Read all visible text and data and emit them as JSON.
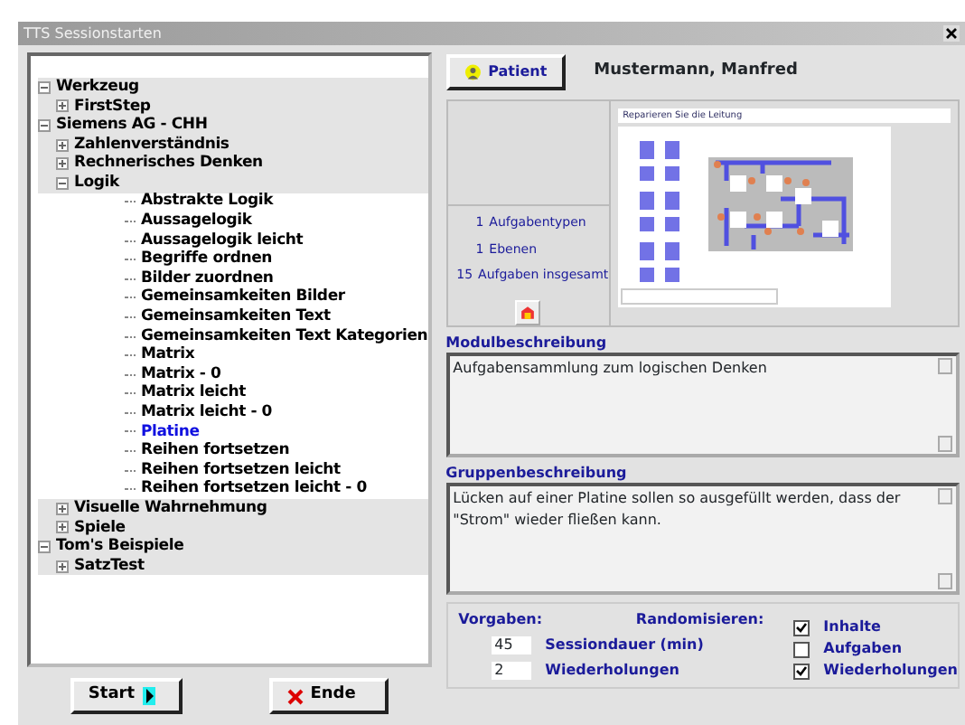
{
  "window": {
    "title": "TTS  Sessionstarten"
  },
  "tree": [
    {
      "label": "Werkzeug",
      "expanded": true,
      "selected": false,
      "children": [
        {
          "label": "FirstStep",
          "expanded": false,
          "selected": false
        }
      ]
    },
    {
      "label": "Siemens AG - CHH",
      "expanded": true,
      "selected": false,
      "children": [
        {
          "label": "Zahlenverständnis",
          "expanded": false,
          "selected": false
        },
        {
          "label": "Rechnerisches Denken",
          "expanded": false,
          "selected": false
        },
        {
          "label": "Logik",
          "expanded": true,
          "selected": false,
          "children": [
            {
              "label": "Abstrakte Logik",
              "selected": false
            },
            {
              "label": "Aussagelogik",
              "selected": false
            },
            {
              "label": "Aussagelogik leicht",
              "selected": false
            },
            {
              "label": "Begriffe ordnen",
              "selected": false
            },
            {
              "label": "Bilder zuordnen",
              "selected": false
            },
            {
              "label": "Gemeinsamkeiten Bilder",
              "selected": false
            },
            {
              "label": "Gemeinsamkeiten Text",
              "selected": false
            },
            {
              "label": "Gemeinsamkeiten Text Kategorien",
              "selected": false
            },
            {
              "label": "Matrix",
              "selected": false
            },
            {
              "label": "Matrix - 0",
              "selected": false
            },
            {
              "label": "Matrix leicht",
              "selected": false
            },
            {
              "label": "Matrix leicht - 0",
              "selected": false
            },
            {
              "label": "Platine",
              "selected": true
            },
            {
              "label": "Reihen fortsetzen",
              "selected": false
            },
            {
              "label": "Reihen fortsetzen leicht",
              "selected": false
            },
            {
              "label": "Reihen fortsetzen leicht - 0",
              "selected": false
            }
          ]
        },
        {
          "label": "Visuelle Wahrnehmung",
          "expanded": false,
          "selected": false
        },
        {
          "label": "Spiele",
          "expanded": false,
          "selected": false
        }
      ]
    },
    {
      "label": "Tom's Beispiele",
      "expanded": true,
      "selected": false,
      "children": [
        {
          "label": "SatzTest",
          "expanded": false,
          "selected": false
        }
      ]
    }
  ],
  "buttons": {
    "start": "Start",
    "end": "Ende"
  },
  "patient": {
    "button": "Patient",
    "name": "Mustermann, Manfred"
  },
  "stats": [
    {
      "count": "1",
      "label": "Aufgabentypen"
    },
    {
      "count": "1",
      "label": "Ebenen"
    },
    {
      "count": "15",
      "label": "Aufgaben insgesamt"
    }
  ],
  "preview": {
    "title": "Reparieren Sie die Leitung"
  },
  "module_description": {
    "label": "Modulbeschreibung",
    "text": "Aufgabensammlung zum logischen Denken"
  },
  "group_description": {
    "label": "Gruppenbeschreibung",
    "text": "Lücken auf einer Platine sollen so ausgefüllt werden, dass der \"Strom\" wieder fließen kann."
  },
  "settings": {
    "defaults_label": "Vorgaben:",
    "randomize_label": "Randomisieren:",
    "fields": [
      {
        "value": "45",
        "label": "Sessiondauer (min)"
      },
      {
        "value": "2",
        "label": "Wiederholungen"
      }
    ],
    "checkboxes": [
      {
        "label": "Inhalte",
        "checked": true
      },
      {
        "label": "Aufgaben",
        "checked": false
      },
      {
        "label": "Wiederholungen",
        "checked": true
      }
    ]
  }
}
